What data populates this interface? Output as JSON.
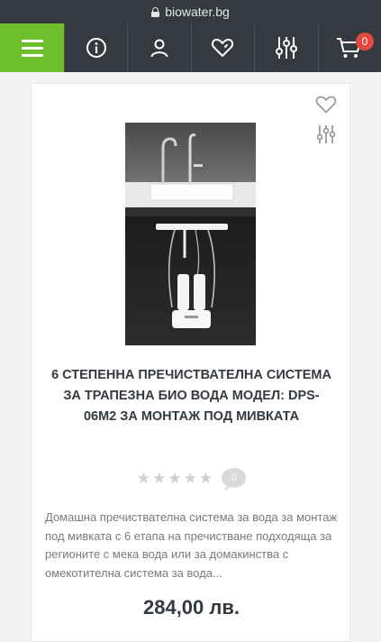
{
  "browser": {
    "url": "biowater.bg"
  },
  "nav": {
    "menu_icon": "hamburger-icon",
    "items": [
      {
        "icon": "info-icon"
      },
      {
        "icon": "user-icon"
      },
      {
        "icon": "heart-icon"
      },
      {
        "icon": "filters-icon"
      },
      {
        "icon": "cart-icon",
        "badge": "0"
      }
    ],
    "accent_color": "#6fbf2a",
    "bar_color": "#343a40"
  },
  "product": {
    "title": "6 СТЕПЕННА ПРЕЧИСТВАТЕЛНА СИСТЕМА ЗА ТРАПЕЗНА БИО ВОДА МОДЕЛ: DPS-06M2 ЗА МОНТАЖ ПОД МИВКАТА",
    "rating_stars": 0,
    "review_count": "0",
    "description": "Домашна пречиствателна система за вода за монтаж под мивката с 6 етапа на пречистване подходяща за регионите с мека вода или за домакинства с омекотителна система за вода...",
    "price": "284,00 лв."
  }
}
